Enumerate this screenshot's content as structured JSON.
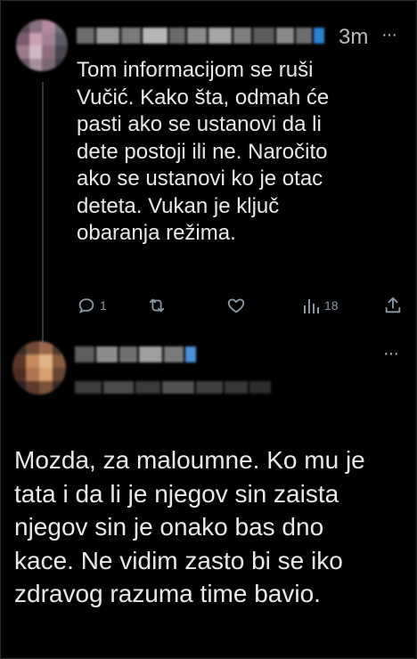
{
  "tweet": {
    "time": "3m",
    "more_label": "···",
    "text": "Tom informacijom se ruši\nVučić. Kako šta, odmah će\npasti ako se ustanovi da li\ndete postoji ili ne. Naročito\nako se ustanovi ko je otac\ndeteta. Vukan je ključ\nobaranja režima.",
    "replies": "1",
    "views": "18"
  },
  "reply_tweet": {
    "more_label": "···",
    "text": "Mozda, za maloumne. Ko mu je\ntata i da li je njegov sin zaista\nnjegov sin je onako bas dno\nkace. Ne vidim zasto bi se iko\nzdravog razuma time bavio."
  },
  "colors": {
    "background": "#000000",
    "text": "#e7e9ea",
    "muted": "#8b98a5",
    "thread_line": "#333639"
  }
}
